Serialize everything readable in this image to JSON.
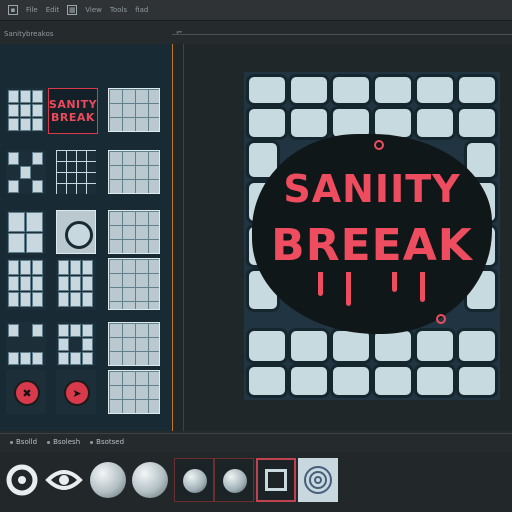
{
  "menubar": {
    "items": [
      "File",
      "Edit",
      "View",
      "Tools",
      "fiad"
    ]
  },
  "toolbar2": {
    "label": "Sanitybreakos",
    "mark": "⌐"
  },
  "logo_tile": {
    "line1": "SANITY",
    "line2": "BREAK"
  },
  "artwork": {
    "title_line1": "SANIITY",
    "title_line2": "BREEAK"
  },
  "bottom_bar": {
    "items": [
      "Bsolld",
      "Bsolesh",
      "Bsotsed"
    ]
  },
  "colors": {
    "accent_red": "#ee4d5f",
    "tile_light": "#c7dadf",
    "panel_bg": "#182a33",
    "orange_rule": "#c2741e"
  }
}
